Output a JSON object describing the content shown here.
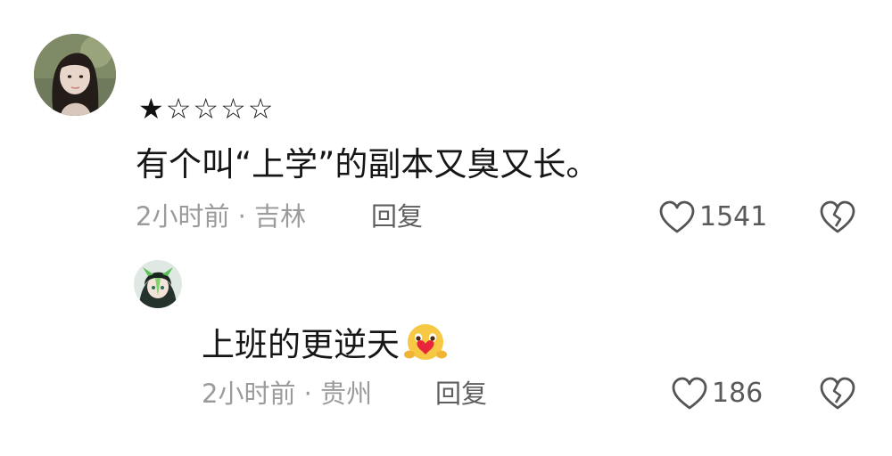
{
  "comment": {
    "rating": {
      "filled": 1,
      "total": 5,
      "filled_char": "★",
      "empty_char": "☆"
    },
    "text": "有个叫“上学”的副本又臭又长。",
    "meta": "2小时前 · 吉林",
    "reply_label": "回复",
    "like_count": "1541",
    "avatar_icon": "user-avatar-photo"
  },
  "reply": {
    "text": "上班的更逆天",
    "emoji_icon": "heart-hug-emoji",
    "meta": "2小时前 · 贵州",
    "reply_label": "回复",
    "like_count": "186",
    "avatar_icon": "user-avatar-anime"
  },
  "icons": {
    "like": "heart-outline-icon",
    "dislike": "broken-heart-icon"
  },
  "colors": {
    "text": "#161616",
    "meta": "#9b9b9b",
    "action": "#5e5e5e",
    "icon": "#555555",
    "emoji": "#f7c843",
    "emoji_heart": "#e8253a"
  }
}
